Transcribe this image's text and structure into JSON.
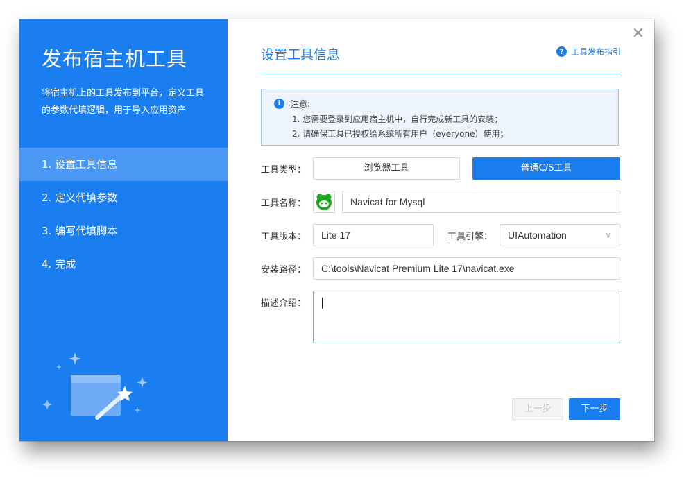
{
  "sidebar": {
    "title": "发布宿主机工具",
    "description": "将宿主机上的工具发布到平台，定义工具的参数代填逻辑，用于导入应用资产",
    "steps": [
      {
        "label": "1. 设置工具信息",
        "active": true
      },
      {
        "label": "2. 定义代填参数",
        "active": false
      },
      {
        "label": "3. 编写代填脚本",
        "active": false
      },
      {
        "label": "4. 完成",
        "active": false
      }
    ]
  },
  "header": {
    "title": "设置工具信息",
    "guide_label": "工具发布指引",
    "close_symbol": "×"
  },
  "notice": {
    "heading": "注意:",
    "lines": [
      "1. 您需要登录到应用宿主机中，自行完成新工具的安装；",
      "2. 请确保工具已授权给系统所有用户（everyone）使用；"
    ]
  },
  "form": {
    "tool_type": {
      "label": "工具类型：",
      "options": [
        "浏览器工具",
        "普通C/S工具"
      ],
      "selected": "普通C/S工具"
    },
    "tool_name": {
      "label": "工具名称：",
      "value": "Navicat for Mysql",
      "icon": "navicat-icon"
    },
    "tool_version": {
      "label": "工具版本：",
      "value": "Lite 17"
    },
    "tool_engine": {
      "label": "工具引擎：",
      "value": "UIAutomation"
    },
    "install_path": {
      "label": "安装路径：",
      "value": "C:\\tools\\Navicat Premium Lite 17\\navicat.exe"
    },
    "description": {
      "label": "描述介绍：",
      "value": ""
    }
  },
  "footer": {
    "prev_label": "上一步",
    "next_label": "下一步"
  },
  "colors": {
    "accent": "#1b7ef0",
    "sidebar_active": "#4a98f3",
    "notice_bg": "#edf4fe"
  }
}
